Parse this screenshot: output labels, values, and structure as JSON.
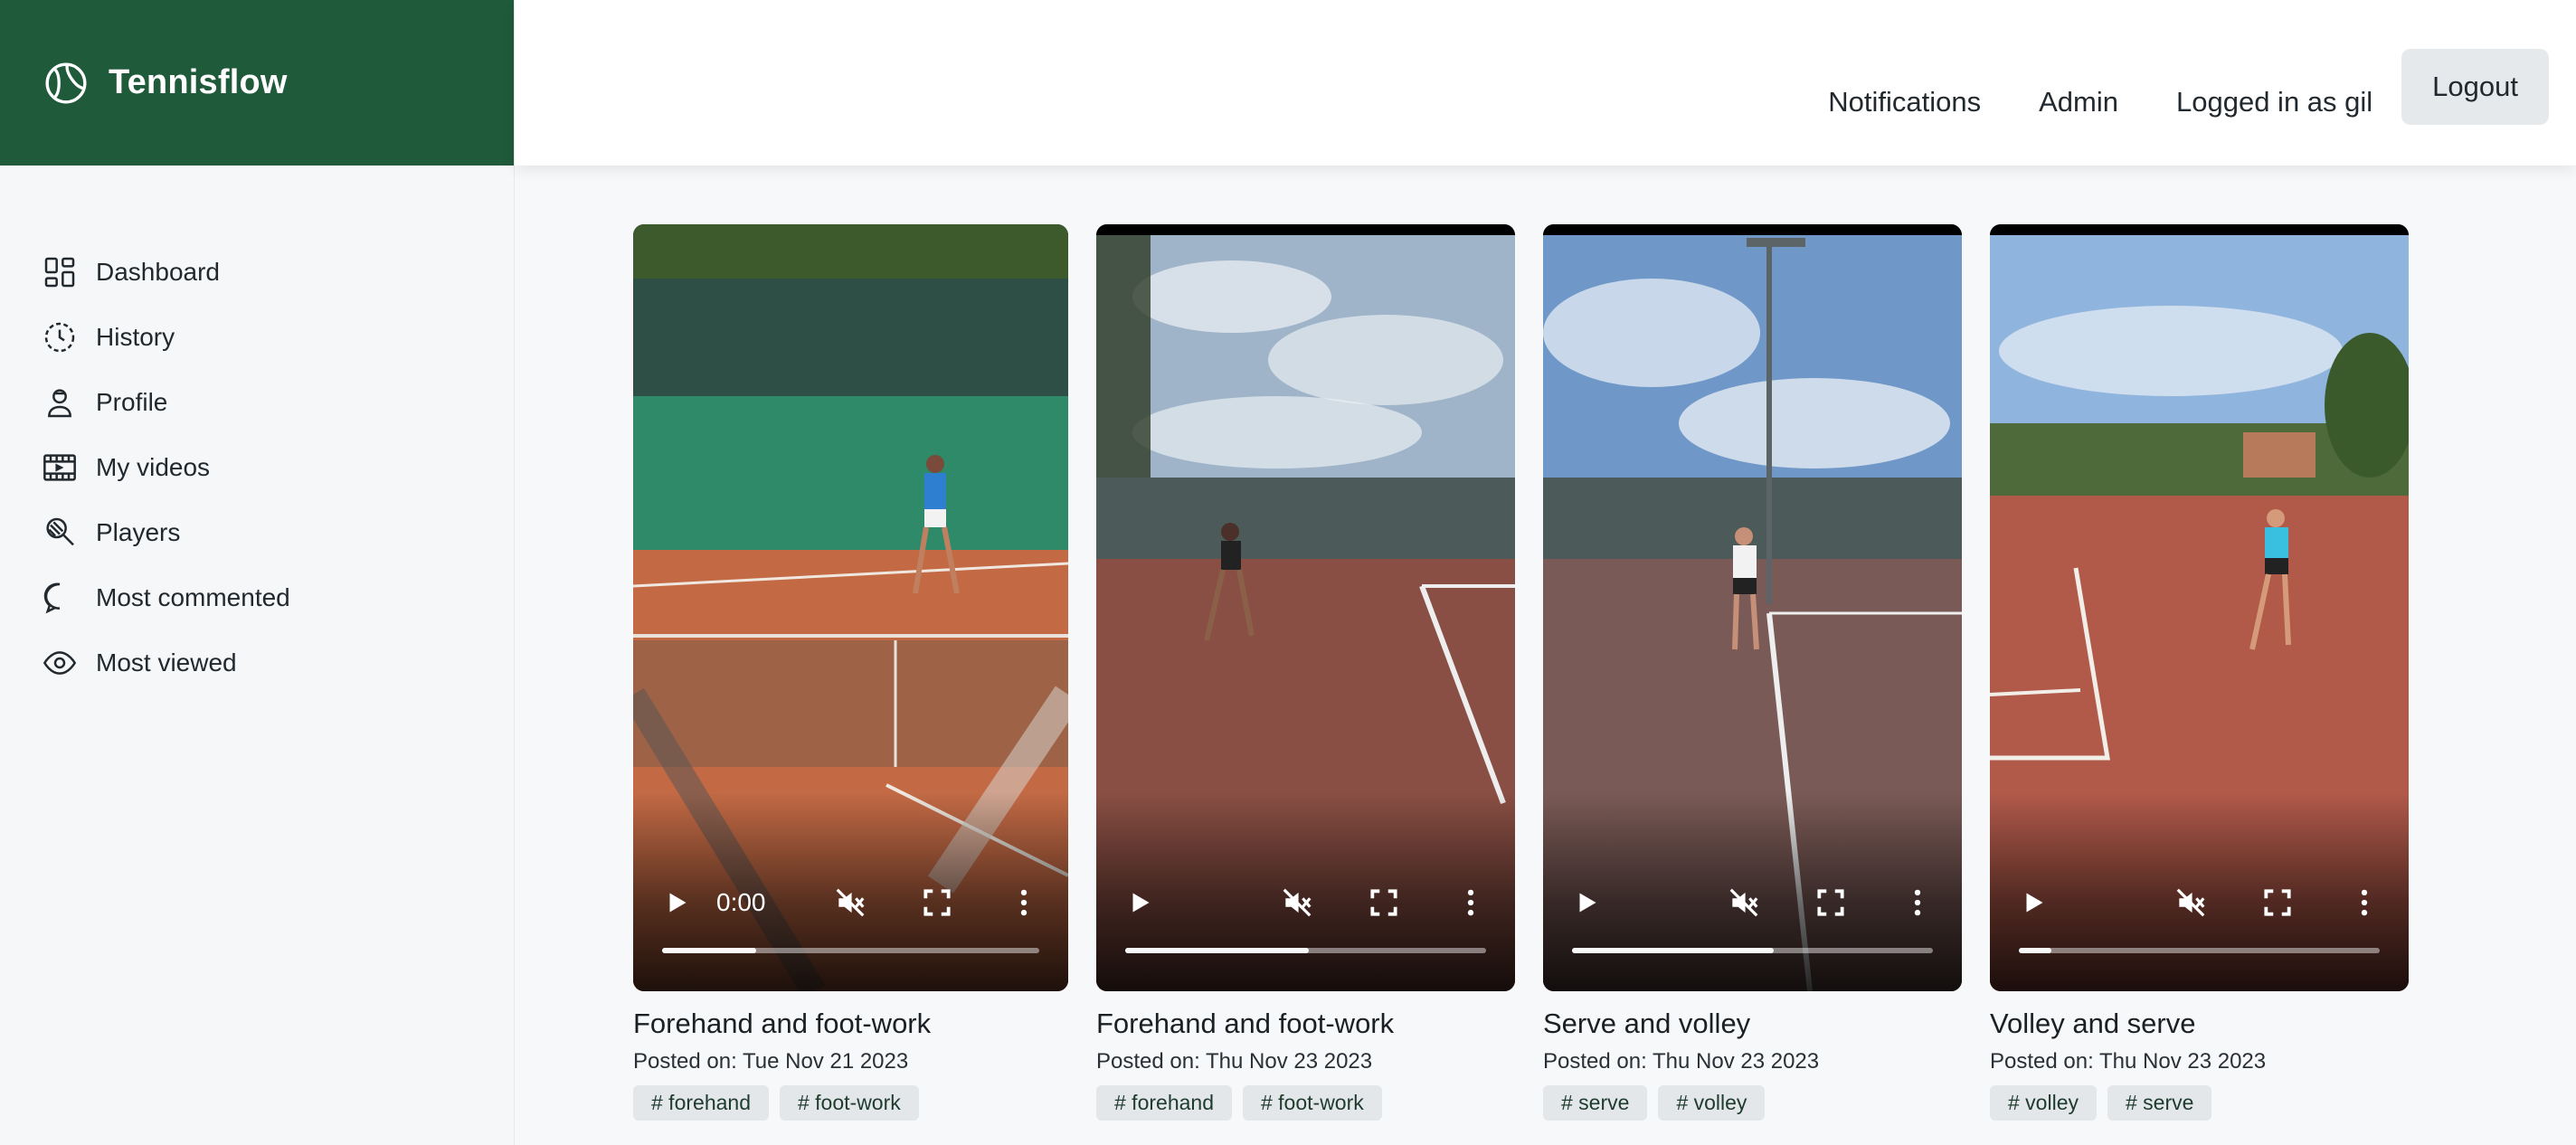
{
  "brand": {
    "name": "Tennisflow",
    "color": "#1f5a3a"
  },
  "sidebar": {
    "items": [
      {
        "label": "Dashboard",
        "icon": "dashboard-icon"
      },
      {
        "label": "History",
        "icon": "clock-icon"
      },
      {
        "label": "Profile",
        "icon": "person-icon"
      },
      {
        "label": "My videos",
        "icon": "film-icon"
      },
      {
        "label": "Players",
        "icon": "racket-icon"
      },
      {
        "label": "Most commented",
        "icon": "comment-icon"
      },
      {
        "label": "Most viewed",
        "icon": "eye-icon"
      }
    ]
  },
  "header": {
    "notifications": "Notifications",
    "admin": "Admin",
    "user": "Logged in as gil",
    "logout": "Logout"
  },
  "videos": [
    {
      "title": "Forehand and foot-work",
      "posted": "Posted on: Tue Nov 21 2023",
      "tags": [
        "# forehand",
        "# foot-work"
      ],
      "time": "0:00",
      "progress": 0.25
    },
    {
      "title": "Forehand and foot-work",
      "posted": "Posted on: Thu Nov 23 2023",
      "tags": [
        "# forehand",
        "# foot-work"
      ],
      "time": "",
      "progress": 0.51
    },
    {
      "title": "Serve and volley",
      "posted": "Posted on: Thu Nov 23 2023",
      "tags": [
        "# serve",
        "# volley"
      ],
      "time": "",
      "progress": 0.56
    },
    {
      "title": "Volley and serve",
      "posted": "Posted on: Thu Nov 23 2023",
      "tags": [
        "# volley",
        "# serve"
      ],
      "time": "",
      "progress": 0.09
    }
  ]
}
